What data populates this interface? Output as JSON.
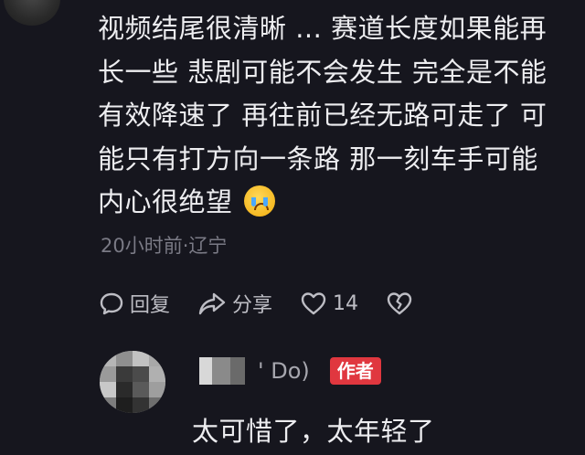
{
  "comment": {
    "lines": [
      "视频结尾很清晰 ... 赛道长度如果能再",
      "长一些 悲剧可能不会发生 完全是不能",
      "有效降速了 再往前已经无路可走了 可",
      "能只有打方向一条路 那一刻车手可能",
      "内心很绝望"
    ],
    "emoji": "crying-face-emoji",
    "meta": "20小时前·辽宁"
  },
  "actions": {
    "reply_label": "回复",
    "share_label": "分享",
    "like_count": "14"
  },
  "reply": {
    "name": "' Do)",
    "badge": "作者",
    "text": "太可惜了，太年轻了"
  },
  "colors": {
    "background": "#16161e",
    "badge": "#e0373f",
    "meta": "#7a7a85"
  }
}
